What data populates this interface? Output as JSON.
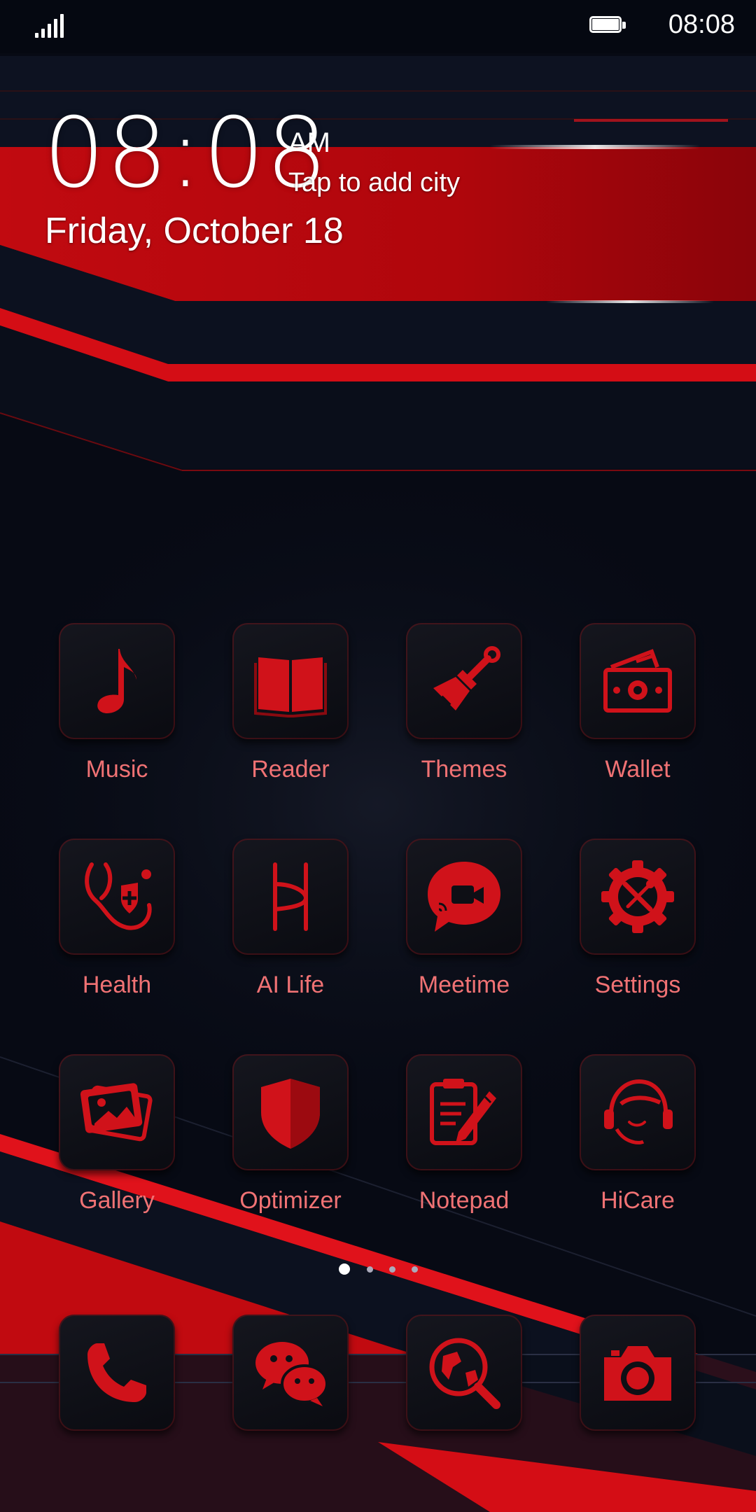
{
  "status_bar": {
    "time": "08:08",
    "battery_percent": 100
  },
  "clock": {
    "time": "08:08",
    "ampm": "AM",
    "city_prompt": "Tap to add city",
    "date": "Friday, October 18"
  },
  "apps": [
    {
      "label": "Music",
      "icon": "music-note-icon"
    },
    {
      "label": "Reader",
      "icon": "book-icon"
    },
    {
      "label": "Themes",
      "icon": "paintbrush-icon"
    },
    {
      "label": "Wallet",
      "icon": "wallet-icon"
    },
    {
      "label": "Health",
      "icon": "stethoscope-icon"
    },
    {
      "label": "AI Life",
      "icon": "ai-life-icon"
    },
    {
      "label": "Meetime",
      "icon": "video-chat-icon"
    },
    {
      "label": "Settings",
      "icon": "gear-icon"
    },
    {
      "label": "Gallery",
      "icon": "gallery-icon"
    },
    {
      "label": "Optimizer",
      "icon": "shield-icon"
    },
    {
      "label": "Notepad",
      "icon": "notepad-icon"
    },
    {
      "label": "HiCare",
      "icon": "headset-icon"
    }
  ],
  "page_indicator": {
    "pages": 4,
    "current": 1
  },
  "dock": [
    {
      "icon": "phone-icon"
    },
    {
      "icon": "chat-bubbles-icon"
    },
    {
      "icon": "browser-globe-icon"
    },
    {
      "icon": "camera-icon"
    }
  ],
  "colors": {
    "accent": "#d0121a",
    "label": "#f07274",
    "background": "#070a14"
  }
}
